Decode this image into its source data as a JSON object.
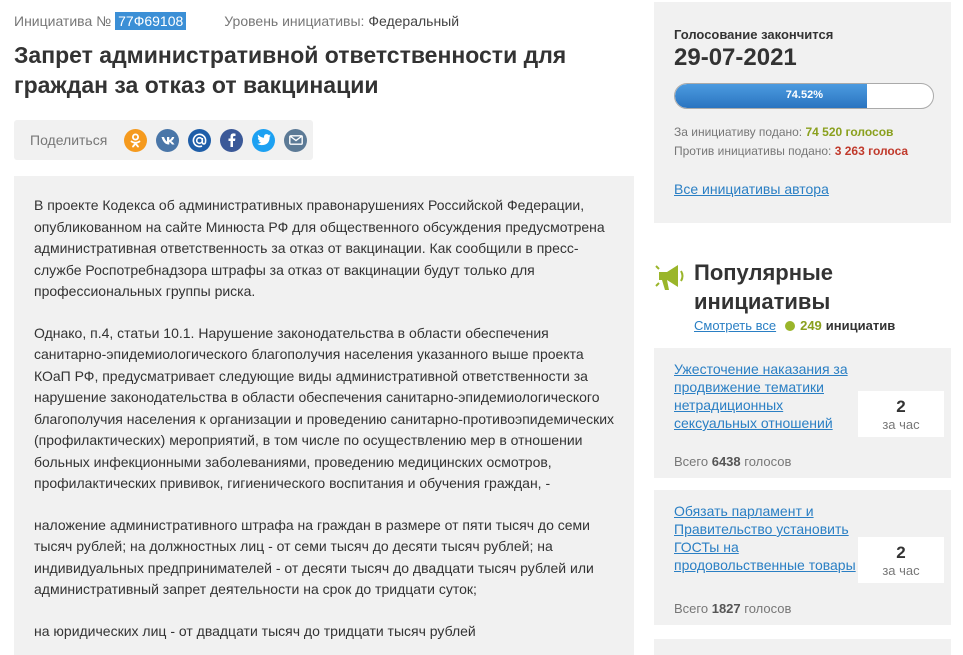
{
  "initiative": {
    "number_label": "Инициатива №",
    "number": "77Ф69108",
    "level_label": "Уровень инициативы:",
    "level": "Федеральный",
    "title": "Запрет административной ответственности для граждан за отказ от вакцинации"
  },
  "share": {
    "label": "Поделиться",
    "icons": [
      "odnoklassniki-icon",
      "vk-icon",
      "mail-ru-icon",
      "facebook-icon",
      "twitter-icon",
      "email-icon"
    ]
  },
  "body_paragraphs": [
    "В проекте Кодекса об административных правонарушениях Российской Федерации, опубликованном на сайте Минюста РФ для общественного обсуждения предусмотрена административная ответственность за отказ от вакцинации. Как сообщили в пресс-службе Роспотребнадзора штрафы за отказ от вакцинации будут только для профессиональных группы риска.",
    "Однако, п.4, статьи 10.1. Нарушение законодательства в области обеспечения санитарно-эпидемиологического благополучия населения указанного выше проекта КОаП РФ, предусматривает следующие виды административной ответственности за нарушение законодательства в области обеспечения санитарно-эпидемиологического благополучия населения к организации и проведению санитарно-противоэпидемических (профилактических) мероприятий, в том числе по осуществлению мер в отношении больных инфекционными заболеваниями, проведению медицинских осмотров, профилактических прививок, гигиенического воспитания и обучения граждан, -",
    "наложение административного штрафа на граждан в размере от пяти тысяч до семи тысяч рублей; на должностных лиц - от семи тысяч до десяти тысяч рублей; на индивидуальных предпринимателей - от десяти тысяч до двадцати тысяч рублей или административный запрет деятельности на срок до тридцати суток;",
    "на юридических лиц - от двадцати тысяч до тридцати тысяч рублей"
  ],
  "vote": {
    "ends_label": "Голосование закончится",
    "end_date": "29-07-2021",
    "percent": 74.52,
    "percent_label": "74.52%",
    "for_label": "За инициативу подано:",
    "for_value": "74 520 голосов",
    "against_label": "Против инициативы подано:",
    "against_value": "3 263 голоса",
    "author_link": "Все инициативы автора",
    "colors": {
      "bar": "#2a74c0",
      "for": "#8aa01e",
      "against": "#c0392b"
    }
  },
  "popular": {
    "title": "Популярные инициативы",
    "see_all": "Смотреть все",
    "count": "249",
    "count_label": "инициатив",
    "items": [
      {
        "title": "Ужесточение наказания за продвижение тематики нетрадиционных сексуальных отношений",
        "rate": "2",
        "rate_unit": "за час",
        "total_label": "Всего",
        "total": "6438",
        "total_unit": "голосов"
      },
      {
        "title": "Обязать парламент и Правительство установить ГОСТы на продовольственные товары",
        "rate": "2",
        "rate_unit": "за час",
        "total_label": "Всего",
        "total": "1827",
        "total_unit": "голосов"
      }
    ]
  }
}
